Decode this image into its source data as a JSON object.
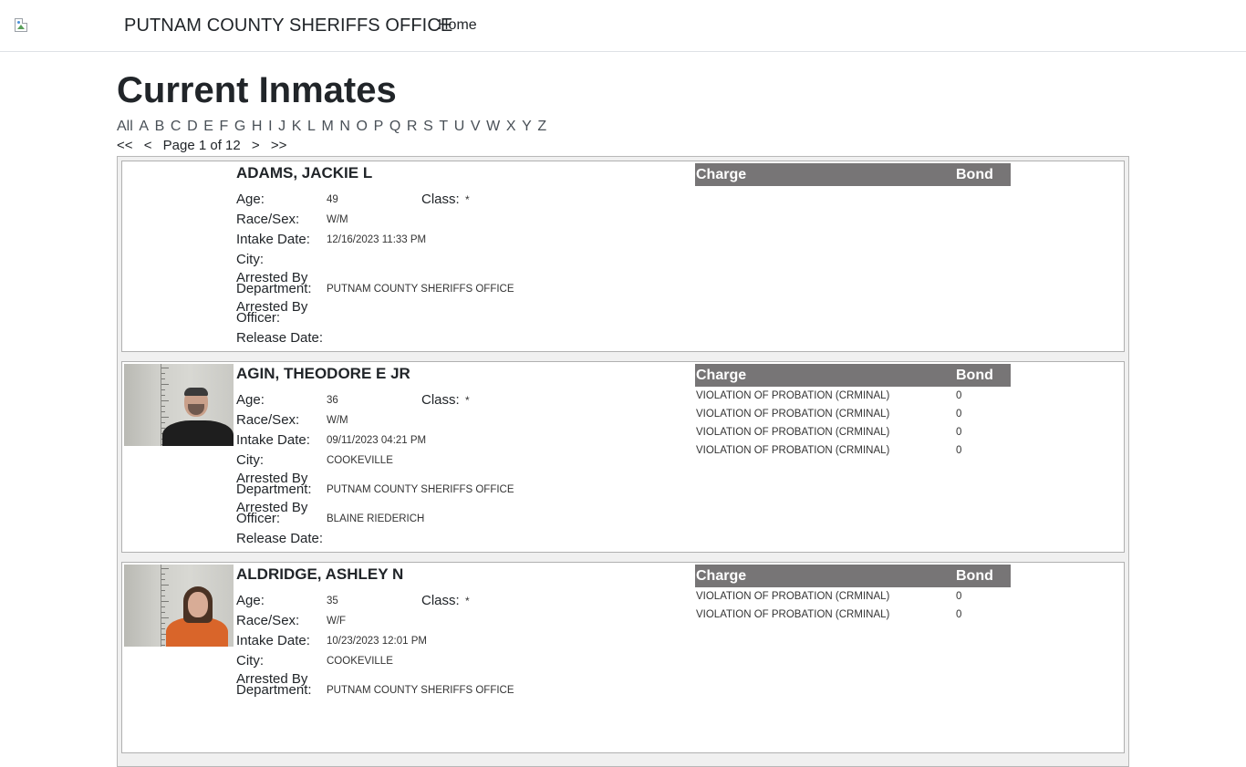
{
  "nav": {
    "brand": "PUTNAM COUNTY SHERIFFS OFFICE",
    "home": "Home"
  },
  "page": {
    "title": "Current Inmates"
  },
  "alphabet": [
    "All",
    "A",
    "B",
    "C",
    "D",
    "E",
    "F",
    "G",
    "H",
    "I",
    "J",
    "K",
    "L",
    "M",
    "N",
    "O",
    "P",
    "Q",
    "R",
    "S",
    "T",
    "U",
    "V",
    "W",
    "X",
    "Y",
    "Z"
  ],
  "pager": {
    "first": "<<",
    "prev": "<",
    "label": "Page 1 of 12",
    "next": ">",
    "last": ">>"
  },
  "labels": {
    "age": "Age:",
    "class": "Class:",
    "race_sex": "Race/Sex:",
    "intake": "Intake Date:",
    "city": "City:",
    "dept": "Arrested By Department:",
    "officer": "Arrested By Officer:",
    "release": "Release Date:",
    "charge": "Charge",
    "bond": "Bond"
  },
  "inmates": [
    {
      "name": "ADAMS, JACKIE L",
      "age": "49",
      "class": "*",
      "race_sex": "W/M",
      "intake": "12/16/2023 11:33 PM",
      "city": "",
      "dept": "PUTNAM COUNTY SHERIFFS OFFICE",
      "officer": "",
      "release": "",
      "charges": []
    },
    {
      "name": "AGIN, THEODORE E JR",
      "age": "36",
      "class": "*",
      "race_sex": "W/M",
      "intake": "09/11/2023 04:21 PM",
      "city": "COOKEVILLE",
      "dept": "PUTNAM COUNTY SHERIFFS OFFICE",
      "officer": "BLAINE RIEDERICH",
      "release": "",
      "charges": [
        {
          "charge": "VIOLATION OF PROBATION (CRMINAL)",
          "bond": "0"
        },
        {
          "charge": "VIOLATION OF PROBATION (CRMINAL)",
          "bond": "0"
        },
        {
          "charge": "VIOLATION OF PROBATION (CRMINAL)",
          "bond": "0"
        },
        {
          "charge": "VIOLATION OF PROBATION (CRMINAL)",
          "bond": "0"
        }
      ]
    },
    {
      "name": "ALDRIDGE, ASHLEY N",
      "age": "35",
      "class": "*",
      "race_sex": "W/F",
      "intake": "10/23/2023 12:01 PM",
      "city": "COOKEVILLE",
      "dept": "PUTNAM COUNTY SHERIFFS OFFICE",
      "officer": "",
      "release": "",
      "charges": [
        {
          "charge": "VIOLATION OF PROBATION (CRMINAL)",
          "bond": "0"
        },
        {
          "charge": "VIOLATION OF PROBATION (CRMINAL)",
          "bond": "0"
        }
      ]
    }
  ],
  "colors": {
    "charge_header_bg": "#777576",
    "border": "#b0b0b0"
  }
}
